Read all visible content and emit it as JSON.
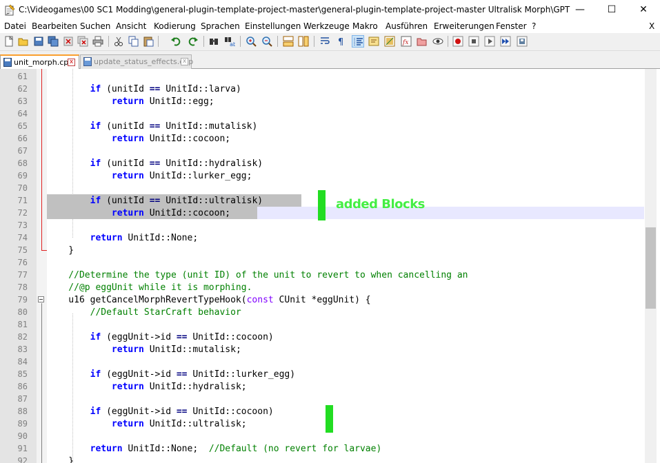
{
  "window": {
    "title": "C:\\Videogames\\00 SC1 Modding\\general-plugin-template-project-master\\general-plugin-template-project-master Ultralisk Morph\\GPTP\\src\\hook...",
    "minimize": "—",
    "maximize": "☐",
    "close": "✕"
  },
  "menu": {
    "items": [
      "Datei",
      "Bearbeiten",
      "Suchen",
      "Ansicht",
      "Kodierung",
      "Sprachen",
      "Einstellungen",
      "Werkzeuge",
      "Makro",
      "Ausführen",
      "Erweiterungen",
      "Fenster",
      "?"
    ],
    "close": "X"
  },
  "toolbar": {
    "icons": [
      "new-file-icon",
      "open-file-icon",
      "save-icon",
      "save-all-icon",
      "close-file-icon",
      "close-all-icon",
      "print-icon",
      "cut-icon",
      "copy-icon",
      "paste-icon",
      "undo-icon",
      "redo-icon",
      "find-icon",
      "replace-icon",
      "zoom-in-icon",
      "zoom-out-icon",
      "sync-vertical-icon",
      "sync-horizontal-icon",
      "word-wrap-icon",
      "show-all-chars-icon",
      "indent-guide-icon",
      "language-icon",
      "doc-map-icon",
      "function-list-icon",
      "folder-workspace-icon",
      "monitor-icon",
      "record-macro-icon",
      "stop-macro-icon",
      "play-macro-icon",
      "run-macro-multiple-icon",
      "save-macro-icon"
    ]
  },
  "tabs": [
    {
      "label": "unit_morph.cpp",
      "active": true,
      "close": "x"
    },
    {
      "label": "update_status_effects.cpp",
      "active": false,
      "close": "x"
    }
  ],
  "editor": {
    "lines": [
      {
        "n": "61",
        "tokens": []
      },
      {
        "n": "62",
        "tokens": [
          [
            "pl",
            "        "
          ],
          [
            "kw",
            "if"
          ],
          [
            "pl",
            " (unitId "
          ],
          [
            "op",
            "=="
          ],
          [
            "pl",
            " UnitId::larva)"
          ]
        ]
      },
      {
        "n": "63",
        "tokens": [
          [
            "pl",
            "            "
          ],
          [
            "kw",
            "return"
          ],
          [
            "pl",
            " UnitId::egg;"
          ]
        ]
      },
      {
        "n": "64",
        "tokens": []
      },
      {
        "n": "65",
        "tokens": [
          [
            "pl",
            "        "
          ],
          [
            "kw",
            "if"
          ],
          [
            "pl",
            " (unitId "
          ],
          [
            "op",
            "=="
          ],
          [
            "pl",
            " UnitId::mutalisk)"
          ]
        ]
      },
      {
        "n": "66",
        "tokens": [
          [
            "pl",
            "            "
          ],
          [
            "kw",
            "return"
          ],
          [
            "pl",
            " UnitId::cocoon;"
          ]
        ]
      },
      {
        "n": "67",
        "tokens": []
      },
      {
        "n": "68",
        "tokens": [
          [
            "pl",
            "        "
          ],
          [
            "kw",
            "if"
          ],
          [
            "pl",
            " (unitId "
          ],
          [
            "op",
            "=="
          ],
          [
            "pl",
            " UnitId::hydralisk)"
          ]
        ]
      },
      {
        "n": "69",
        "tokens": [
          [
            "pl",
            "            "
          ],
          [
            "kw",
            "return"
          ],
          [
            "pl",
            " UnitId::lurker_egg;"
          ]
        ]
      },
      {
        "n": "70",
        "tokens": []
      },
      {
        "n": "71",
        "tokens": [
          [
            "pl",
            "        "
          ],
          [
            "kw",
            "if"
          ],
          [
            "pl",
            " (unitId "
          ],
          [
            "op",
            "=="
          ],
          [
            "pl",
            " UnitId::ultralisk)"
          ]
        ]
      },
      {
        "n": "72",
        "tokens": [
          [
            "pl",
            "            "
          ],
          [
            "kw",
            "return"
          ],
          [
            "pl",
            " UnitId::cocoon;"
          ]
        ]
      },
      {
        "n": "73",
        "tokens": []
      },
      {
        "n": "74",
        "tokens": [
          [
            "pl",
            "        "
          ],
          [
            "kw",
            "return"
          ],
          [
            "pl",
            " UnitId::None;"
          ]
        ]
      },
      {
        "n": "75",
        "tokens": [
          [
            "pl",
            "    }"
          ]
        ]
      },
      {
        "n": "76",
        "tokens": []
      },
      {
        "n": "77",
        "tokens": [
          [
            "cm",
            "    //Determine the type (unit ID) of the unit to revert to when cancelling an"
          ]
        ]
      },
      {
        "n": "78",
        "tokens": [
          [
            "cm",
            "    //@p eggUnit while it is morphing."
          ]
        ]
      },
      {
        "n": "79",
        "tokens": [
          [
            "pl",
            "    u16 getCancelMorphRevertTypeHook("
          ],
          [
            "ty",
            "const"
          ],
          [
            "pl",
            " CUnit *eggUnit) {"
          ]
        ]
      },
      {
        "n": "80",
        "tokens": [
          [
            "cm",
            "        //Default StarCraft behavior"
          ]
        ]
      },
      {
        "n": "81",
        "tokens": []
      },
      {
        "n": "82",
        "tokens": [
          [
            "pl",
            "        "
          ],
          [
            "kw",
            "if"
          ],
          [
            "pl",
            " (eggUnit->id "
          ],
          [
            "op",
            "=="
          ],
          [
            "pl",
            " UnitId::cocoon)"
          ]
        ]
      },
      {
        "n": "83",
        "tokens": [
          [
            "pl",
            "            "
          ],
          [
            "kw",
            "return"
          ],
          [
            "pl",
            " UnitId::mutalisk;"
          ]
        ]
      },
      {
        "n": "84",
        "tokens": []
      },
      {
        "n": "85",
        "tokens": [
          [
            "pl",
            "        "
          ],
          [
            "kw",
            "if"
          ],
          [
            "pl",
            " (eggUnit->id "
          ],
          [
            "op",
            "=="
          ],
          [
            "pl",
            " UnitId::lurker_egg)"
          ]
        ]
      },
      {
        "n": "86",
        "tokens": [
          [
            "pl",
            "            "
          ],
          [
            "kw",
            "return"
          ],
          [
            "pl",
            " UnitId::hydralisk;"
          ]
        ]
      },
      {
        "n": "87",
        "tokens": []
      },
      {
        "n": "88",
        "tokens": [
          [
            "pl",
            "        "
          ],
          [
            "kw",
            "if"
          ],
          [
            "pl",
            " (eggUnit->id "
          ],
          [
            "op",
            "=="
          ],
          [
            "pl",
            " UnitId::cocoon)"
          ]
        ]
      },
      {
        "n": "89",
        "tokens": [
          [
            "pl",
            "            "
          ],
          [
            "kw",
            "return"
          ],
          [
            "pl",
            " UnitId::ultralisk;"
          ]
        ]
      },
      {
        "n": "90",
        "tokens": []
      },
      {
        "n": "91",
        "tokens": [
          [
            "pl",
            "        "
          ],
          [
            "kw",
            "return"
          ],
          [
            "pl",
            " UnitId::None;  "
          ],
          [
            "cm",
            "//Default (no revert for larvae)"
          ]
        ]
      },
      {
        "n": "92",
        "tokens": [
          [
            "pl",
            "    }"
          ]
        ]
      }
    ]
  },
  "annotation": {
    "text": "added Blocks",
    "color": "#44ee44"
  },
  "colors": {
    "keyword": "#0000ff",
    "type": "#8000ff",
    "comment": "#008000",
    "selection": "#c0c0c0",
    "current_line": "#e8e8ff",
    "marker": "#22dd22"
  }
}
